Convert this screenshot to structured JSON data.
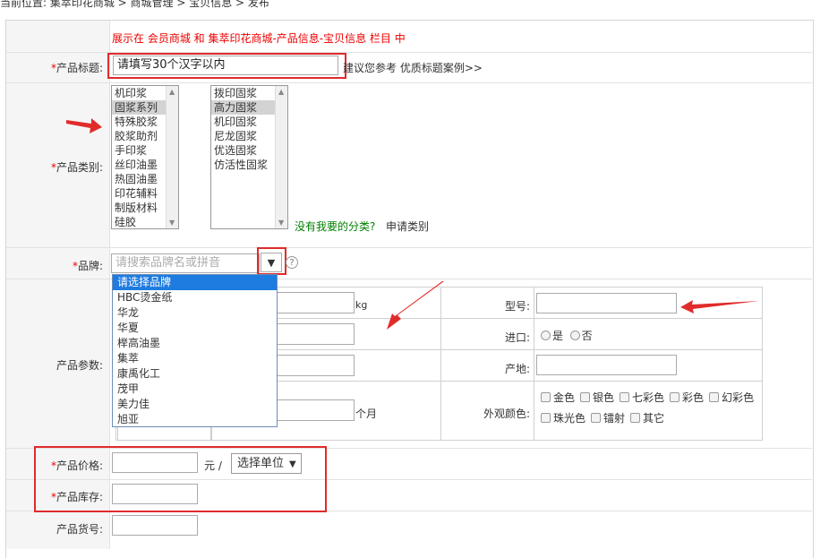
{
  "breadcrumb": "当前位置: 集萃印花商城 > 商城管理 > 宝贝信息 > 发布",
  "info": "展示在 会员商城 和 集萃印花商城-产品信息-宝贝信息 栏目 中",
  "title_field": {
    "label": "产品标题:",
    "required": "*",
    "value": "请填写30个汉字以内",
    "hint": "建议您参考 优质标题案例>>"
  },
  "category": {
    "label": "产品类别:",
    "required": "*",
    "list1": [
      "机印浆",
      "固浆系列",
      "特殊胶浆",
      "胶浆助剂",
      "手印浆",
      "丝印油墨",
      "热固油墨",
      "印花辅料",
      "制版材料",
      "硅胶"
    ],
    "list1_selected": 1,
    "list2": [
      "拨印固浆",
      "高力固浆",
      "机印固浆",
      "尼龙固浆",
      "优选固浆",
      "仿活性固浆"
    ],
    "list2_selected": 1,
    "no_category": "没有我要的分类?",
    "apply": "申请类别"
  },
  "brand": {
    "label": "品牌:",
    "required": "*",
    "placeholder": "请搜索品牌名或拼音",
    "arrow": "▼",
    "help": "?",
    "options": [
      "请选择品牌",
      "HBC烫金纸",
      "华龙",
      "华夏",
      "榉高油墨",
      "集萃",
      "康禹化工",
      "茂甲",
      "美力佳",
      "旭亚"
    ],
    "highlighted": 0
  },
  "params": {
    "label": "产品参数:",
    "kg_unit": "kg",
    "month_unit": "个月",
    "model_label": "型号:",
    "import_label": "进口:",
    "import_yes": "是",
    "import_no": "否",
    "origin_label": "产地:",
    "color_label": "外观颜色:",
    "colors_row1": [
      "金色",
      "银色",
      "七彩色",
      "彩色",
      "幻彩色"
    ],
    "colors_row2": [
      "珠光色",
      "镭射",
      "其它"
    ]
  },
  "price": {
    "label": "产品价格:",
    "required": "*",
    "unit_text": "元 /",
    "unit_select": "选择单位",
    "arrow": "▼"
  },
  "stock": {
    "label": "产品库存:",
    "required": "*"
  },
  "sku": {
    "label": "产品货号:"
  },
  "colors": {
    "highlight_red": "#e12b2b",
    "dropdown_highlight": "#1e7be0",
    "category_green": "#008000"
  }
}
